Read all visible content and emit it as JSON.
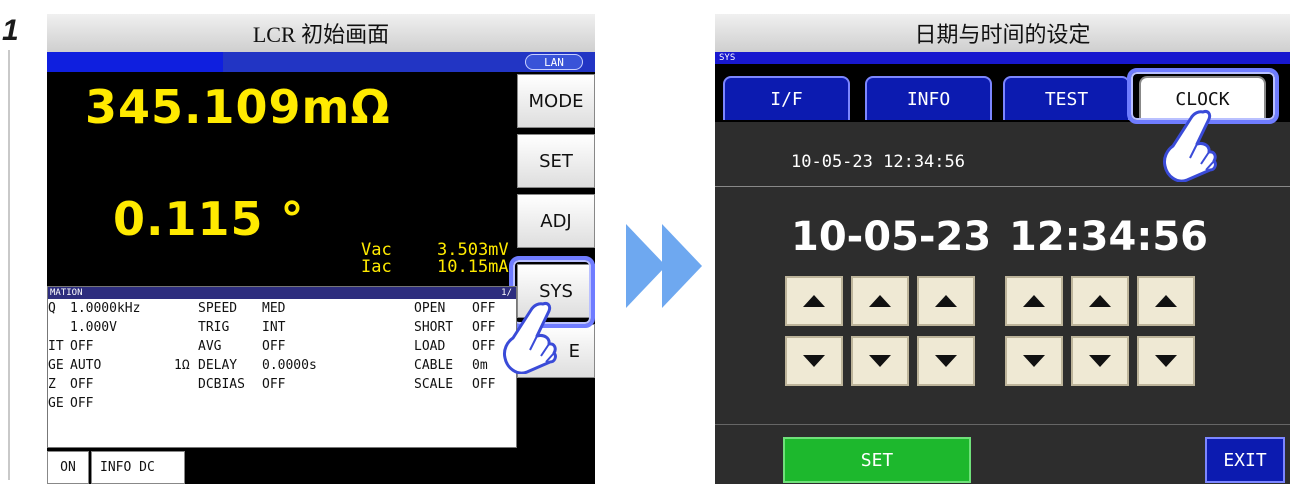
{
  "step_number": "1",
  "left_screen": {
    "title": "LCR 初始画面",
    "lan_badge": "LAN",
    "measurement": {
      "primary_value": "345.109mΩ",
      "secondary_value": "0.115 °"
    },
    "monitor": {
      "vac_label": "Vac",
      "vac_value": "3.503mV",
      "iac_label": "Iac",
      "iac_value": "10.15mA"
    },
    "side_buttons": [
      "MODE",
      "SET",
      "ADJ",
      "SYS",
      "E"
    ],
    "info_panel": {
      "header": "MATION",
      "page": "1/",
      "rows": [
        [
          "Q",
          "1.0000kHz",
          "",
          "SPEED",
          "MED",
          "OPEN",
          "OFF"
        ],
        [
          "",
          "1.000V",
          "",
          "TRIG",
          "INT",
          "SHORT",
          "OFF"
        ],
        [
          "IT",
          "OFF",
          "",
          "AVG",
          "OFF",
          "LOAD",
          "OFF"
        ],
        [
          "GE",
          "AUTO",
          "1Ω",
          "DELAY",
          "0.0000s",
          "CABLE",
          "0m"
        ],
        [
          "Z",
          "OFF",
          "",
          "DCBIAS",
          "OFF",
          "SCALE",
          "OFF"
        ],
        [
          "GE",
          "OFF",
          "",
          "",
          "",
          "",
          ""
        ]
      ]
    },
    "bottom_tabs": [
      "ON",
      "INFO DC"
    ]
  },
  "right_screen": {
    "title": "日期与时间的设定",
    "sys_label": "SYS",
    "tabs": [
      "I/F",
      "INFO",
      "TEST",
      "CLOCK"
    ],
    "active_tab": "CLOCK",
    "current_datetime": "10-05-23 12:34:56",
    "edit_date": "10-05-23",
    "edit_time": "12:34:56",
    "set_label": "SET",
    "exit_label": "EXIT"
  },
  "colors": {
    "measurement_yellow": "#ffea00",
    "tab_blue": "#0c1bb0",
    "highlight_blue": "#6f7cff",
    "set_green": "#1db82d",
    "arrow_blue": "#6ea8f0"
  }
}
